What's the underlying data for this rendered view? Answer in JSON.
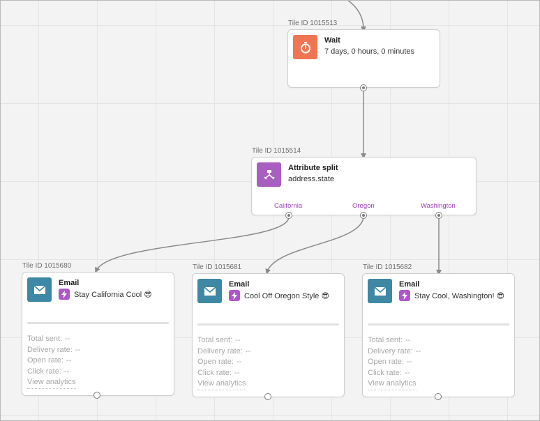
{
  "wait_tile": {
    "tile_id": "Tile ID 1015513",
    "title": "Wait",
    "subtitle": "7 days, 0 hours, 0 minutes",
    "icon": "stopwatch-icon",
    "color": "#ef7553"
  },
  "split_tile": {
    "tile_id": "Tile ID 1015514",
    "title": "Attribute split",
    "subtitle": "address.state",
    "icon": "split-icon",
    "color": "#a95fbf",
    "branches": [
      "California",
      "Oregon",
      "Washington"
    ],
    "branch_color": "#9b3fb8"
  },
  "email_tiles": [
    {
      "tile_id": "Tile ID 1015680",
      "title": "Email",
      "subject": "Stay California Cool 😎",
      "stats": [
        {
          "label": "Total sent:",
          "value": "--"
        },
        {
          "label": "Delivery rate:",
          "value": "--"
        },
        {
          "label": "Open rate:",
          "value": "--"
        },
        {
          "label": "Click rate:",
          "value": "--"
        }
      ],
      "link": "View analytics"
    },
    {
      "tile_id": "Tile ID 1015681",
      "title": "Email",
      "subject": "Cool Off Oregon Style 😎",
      "stats": [
        {
          "label": "Total sent:",
          "value": "--"
        },
        {
          "label": "Delivery rate:",
          "value": "--"
        },
        {
          "label": "Open rate:",
          "value": "--"
        },
        {
          "label": "Click rate:",
          "value": "--"
        }
      ],
      "link": "View analytics"
    },
    {
      "tile_id": "Tile ID 1015682",
      "title": "Email",
      "subject": "Stay Cool, Washington! 😎",
      "stats": [
        {
          "label": "Total sent:",
          "value": "--"
        },
        {
          "label": "Delivery rate:",
          "value": "--"
        },
        {
          "label": "Open rate:",
          "value": "--"
        },
        {
          "label": "Click rate:",
          "value": "--"
        }
      ],
      "link": "View analytics"
    }
  ],
  "colors": {
    "email_icon": "#3e88a5",
    "bolt_icon": "#b057c8",
    "connector": "#8a8a8a"
  }
}
